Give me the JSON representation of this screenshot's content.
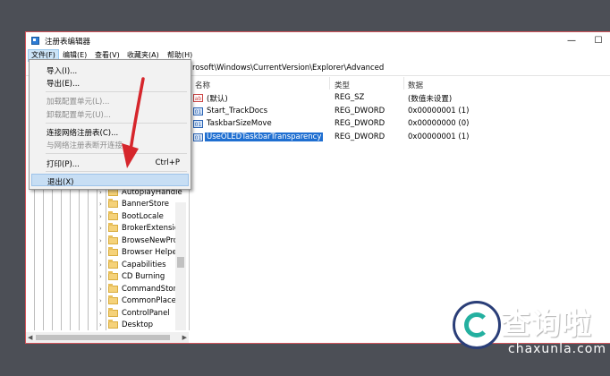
{
  "window": {
    "title": "注册表编辑器",
    "minimize_glyph": "—",
    "maximize_glyph": "☐"
  },
  "menubar": {
    "items": [
      {
        "label": "文件(F)"
      },
      {
        "label": "编辑(E)"
      },
      {
        "label": "查看(V)"
      },
      {
        "label": "收藏夹(A)"
      },
      {
        "label": "帮助(H)"
      }
    ]
  },
  "address": {
    "path": "rosoft\\Windows\\CurrentVersion\\Explorer\\Advanced"
  },
  "file_menu": {
    "items": [
      {
        "label": "导入(I)...",
        "disabled": false
      },
      {
        "label": "导出(E)...",
        "disabled": false
      },
      {
        "label": "加载配置单元(L)...",
        "disabled": true
      },
      {
        "label": "卸载配置单元(U)...",
        "disabled": true
      },
      {
        "label": "连接网络注册表(C)...",
        "disabled": false
      },
      {
        "label": "与网络注册表断开连接",
        "disabled": true
      },
      {
        "label": "打印(P)...",
        "shortcut": "Ctrl+P",
        "disabled": false
      },
      {
        "label": "退出(X)",
        "highlighted": true
      }
    ]
  },
  "values_pane": {
    "headers": {
      "name": "名称",
      "type": "类型",
      "data": "数据"
    },
    "rows": [
      {
        "icon": "string-value-icon",
        "icon_text": "ab",
        "name": "(默认)",
        "type": "REG_SZ",
        "data": "(数值未设置)"
      },
      {
        "icon": "dword-value-icon",
        "icon_text": "01",
        "name": "Start_TrackDocs",
        "type": "REG_DWORD",
        "data": "0x00000001 (1)"
      },
      {
        "icon": "dword-value-icon",
        "icon_text": "01",
        "name": "TaskbarSizeMove",
        "type": "REG_DWORD",
        "data": "0x00000000 (0)"
      },
      {
        "icon": "dword-value-icon",
        "icon_text": "01",
        "name": "UseOLEDTaskbarTransparency",
        "type": "REG_DWORD",
        "data": "0x00000001 (1)",
        "selected": true
      }
    ]
  },
  "tree": {
    "items": [
      {
        "label": "AutoplayHandle"
      },
      {
        "label": "BannerStore"
      },
      {
        "label": "BootLocale"
      },
      {
        "label": "BrokerExtension"
      },
      {
        "label": "BrowseNewProc"
      },
      {
        "label": "Browser Helper"
      },
      {
        "label": "Capabilities"
      },
      {
        "label": "CD Burning"
      },
      {
        "label": "CommandStore"
      },
      {
        "label": "CommonPlaces"
      },
      {
        "label": "ControlPanel"
      },
      {
        "label": "Desktop"
      }
    ]
  },
  "glyphs": {
    "chevron": "›",
    "scroll_left": "◀",
    "scroll_right": "▶"
  },
  "watermark": {
    "text_cn": "查询啦",
    "text_en": "chaxunla.com"
  },
  "colors": {
    "accent_selected": "#1f6fd1",
    "menu_highlight": "#c7def4",
    "arrow": "#d6262c",
    "window_border": "#d4555c",
    "logo_navy": "#2a3e78",
    "logo_teal": "#24b0a0"
  }
}
